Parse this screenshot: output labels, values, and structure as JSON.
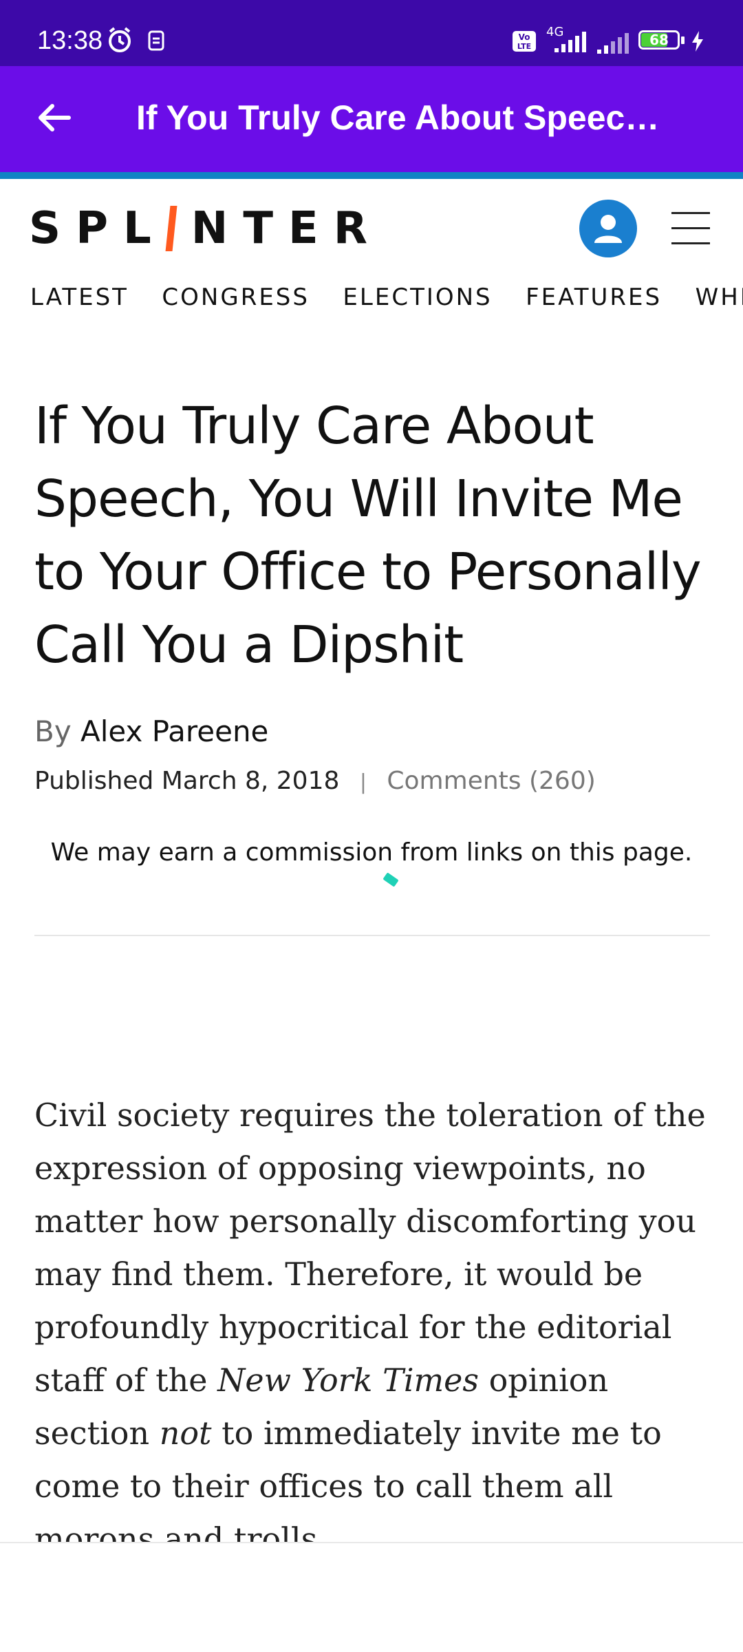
{
  "status_bar": {
    "time": "13:38",
    "network": "4G",
    "battery_level": "68",
    "colors": {
      "background": "#3d09a8",
      "battery_fill": "#4cd137"
    }
  },
  "app_bar": {
    "title": "If You Truly Care About Speec…",
    "colors": {
      "background": "#6b0de8",
      "accent": "#1183c4"
    }
  },
  "site": {
    "logo_left": "SPL",
    "logo_right": "NTER",
    "nav_tabs": [
      "LATEST",
      "CONGRESS",
      "ELECTIONS",
      "FEATURES",
      "WHITE HO"
    ]
  },
  "article": {
    "headline": "If You Truly Care About Speech, You Will Invite Me to Your Office to Personally Call You a Dipshit",
    "by_label": "By",
    "author": "Alex Pareene",
    "published_label": "Published",
    "date": "March 8, 2018",
    "separator": "|",
    "comments": "Comments (260)",
    "disclaimer": "We may earn a commission from links on this page.",
    "body": {
      "part1": "Civil society requires the toleration of the expression of opposing viewpoints, no matter how personally discomforting you may find them. Therefore, it would be profoundly hypocritical for the editorial staff of the ",
      "italic1": "New York Times",
      "part2": " opinion section ",
      "italic2": "not",
      "part3": " to immediately invite me to come to their offices to call them all morons and trolls."
    }
  }
}
